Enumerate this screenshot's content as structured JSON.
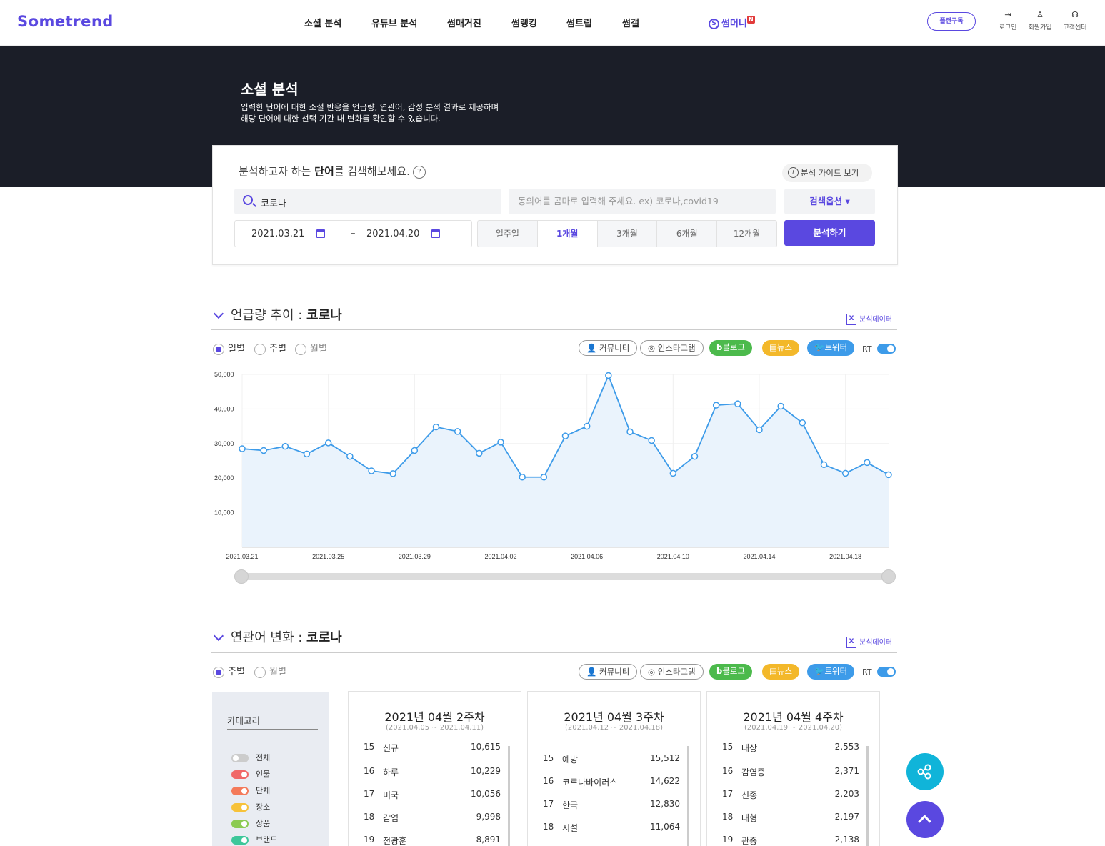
{
  "nav": {
    "logo": "Sometrend",
    "items": [
      "소셜 분석",
      "유튜브 분석",
      "썸매거진",
      "썸랭킹",
      "썸트립",
      "썸갤"
    ],
    "money": "썸머니",
    "money_coin": "S",
    "money_badge": "N",
    "plan_button": "플랜구독",
    "util": [
      {
        "label": "로그인",
        "icon": "login-icon",
        "glyph": "⇥"
      },
      {
        "label": "회원가입",
        "icon": "user-plus-icon",
        "glyph": "♙"
      },
      {
        "label": "고객센터",
        "icon": "headset-icon",
        "glyph": "☊"
      }
    ]
  },
  "hero": {
    "title": "소셜 분석",
    "line1": "입력한 단어에 대한 소셜 반응을 언급량, 연관어, 감성 분석 결과로 제공하며",
    "line2": "해당 단어에 대한 선택 기간 내 변화를 확인할 수 있습니다."
  },
  "search": {
    "title_pre": "분석하고자 하는 ",
    "title_bold": "단어",
    "title_post": "를 검색해보세요.",
    "help_glyph": "?",
    "guide_button": "분석 가이드 보기",
    "guide_glyph": "i",
    "keyword": "코로나",
    "synonym_placeholder": "동의어를 콤마로 입력해 주세요. ex) 코로나,covid19",
    "option_button": "검색옵션 ▾",
    "date_start": "2021.03.21",
    "date_sep": "–",
    "date_end": "2021.04.20",
    "periods": [
      "일주일",
      "1개월",
      "3개월",
      "6개월",
      "12개월"
    ],
    "active_period": "1개월",
    "run_button": "분석하기"
  },
  "mention": {
    "title_pre": "언급량 추이 : ",
    "title_kw": "코로나",
    "excel": "분석데이터",
    "excel_glyph": "X",
    "radios": [
      "일별",
      "주별",
      "월별"
    ],
    "selected": "일별"
  },
  "channels": {
    "community": "커뮤니티",
    "instagram": "인스타그램",
    "blog": "블로그",
    "news": "뉴스",
    "twitter": "트위터",
    "rt": "RT",
    "community_glyph": "👤",
    "instagram_glyph": "◎",
    "blog_glyph": "b",
    "news_glyph": "▤",
    "twitter_glyph": "🐦"
  },
  "chart_data": {
    "type": "area",
    "x": [
      "2021.03.21",
      "2021.03.22",
      "2021.03.23",
      "2021.03.24",
      "2021.03.25",
      "2021.03.26",
      "2021.03.27",
      "2021.03.28",
      "2021.03.29",
      "2021.03.30",
      "2021.03.31",
      "2021.04.01",
      "2021.04.02",
      "2021.04.03",
      "2021.04.04",
      "2021.04.05",
      "2021.04.06",
      "2021.04.07",
      "2021.04.08",
      "2021.04.09",
      "2021.04.10",
      "2021.04.11",
      "2021.04.12",
      "2021.04.13",
      "2021.04.14",
      "2021.04.15",
      "2021.04.16",
      "2021.04.17",
      "2021.04.18",
      "2021.04.19",
      "2021.04.20"
    ],
    "values": [
      28500,
      28000,
      29200,
      27000,
      30200,
      26300,
      22100,
      21300,
      28000,
      34800,
      33500,
      27200,
      30400,
      20300,
      20300,
      32200,
      35000,
      49700,
      33400,
      30900,
      21400,
      26300,
      41100,
      41500,
      34000,
      40800,
      36000,
      23900,
      21400,
      24500,
      21000
    ],
    "x_ticks": [
      "2021.03.21",
      "2021.03.25",
      "2021.03.29",
      "2021.04.02",
      "2021.04.06",
      "2021.04.10",
      "2021.04.14",
      "2021.04.18"
    ],
    "y_ticks": [
      10000,
      20000,
      30000,
      40000,
      50000
    ],
    "y_tick_labels": [
      "10,000",
      "20,000",
      "30,000",
      "40,000",
      "50,000"
    ],
    "ylim": [
      0,
      50000
    ],
    "grid": true,
    "color": "#3d9be9"
  },
  "assoc": {
    "title_pre": "연관어 변화 : ",
    "title_kw": "코로나",
    "excel": "분석데이터",
    "excel_glyph": "X",
    "radios": [
      "주별",
      "월별"
    ],
    "selected": "주별",
    "category_title": "카테고리",
    "categories": [
      {
        "label": "전체",
        "color": "#cccccc",
        "on": false
      },
      {
        "label": "인물",
        "color": "#f06868",
        "on": true
      },
      {
        "label": "단체",
        "color": "#f47a5a",
        "on": true
      },
      {
        "label": "장소",
        "color": "#f7c23a",
        "on": true
      },
      {
        "label": "상품",
        "color": "#8ccb52",
        "on": true
      },
      {
        "label": "브랜드",
        "color": "#3dc79a",
        "on": true
      }
    ],
    "weeks": [
      {
        "title": "2021년 04월 2주차",
        "range": "(2021.04.05 ~ 2021.04.11)",
        "rows": [
          {
            "rank": "15",
            "word": "신규",
            "count": "10,615"
          },
          {
            "rank": "16",
            "word": "하루",
            "count": "10,229"
          },
          {
            "rank": "17",
            "word": "미국",
            "count": "10,056"
          },
          {
            "rank": "18",
            "word": "감염",
            "count": "9,998"
          },
          {
            "rank": "19",
            "word": "전광훈",
            "count": "8,891"
          }
        ]
      },
      {
        "title": "2021년 04월 3주차",
        "range": "(2021.04.12 ~ 2021.04.18)",
        "rows": [
          {
            "rank": "15",
            "word": "예방",
            "count": "15,512"
          },
          {
            "rank": "16",
            "word": "코로나바이러스",
            "count": "14,622"
          },
          {
            "rank": "17",
            "word": "한국",
            "count": "12,830"
          },
          {
            "rank": "18",
            "word": "시설",
            "count": "11,064"
          }
        ]
      },
      {
        "title": "2021년 04월 4주차",
        "range": "(2021.04.19 ~ 2021.04.20)",
        "rows": [
          {
            "rank": "15",
            "word": "대상",
            "count": "2,553"
          },
          {
            "rank": "16",
            "word": "감염증",
            "count": "2,371"
          },
          {
            "rank": "17",
            "word": "신종",
            "count": "2,203"
          },
          {
            "rank": "18",
            "word": "대형",
            "count": "2,197"
          },
          {
            "rank": "19",
            "word": "관종",
            "count": "2,138"
          }
        ]
      }
    ]
  }
}
